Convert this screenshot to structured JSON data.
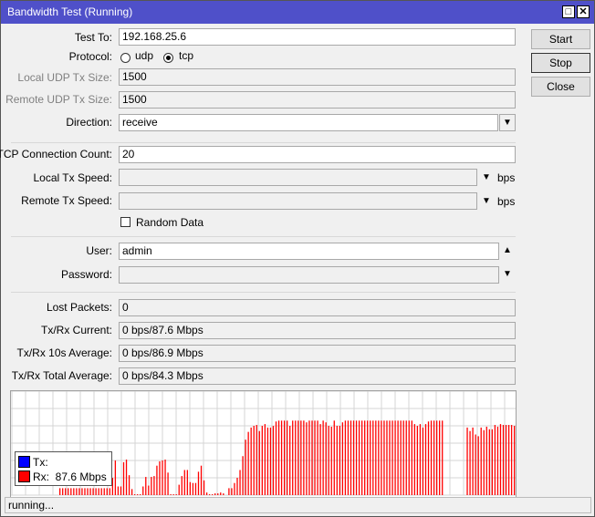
{
  "window": {
    "title": "Bandwidth Test (Running)",
    "maximize_icon": "maximize-icon",
    "close_icon": "close-icon"
  },
  "form": {
    "test_to": {
      "label": "Test To:",
      "value": "192.168.25.6"
    },
    "protocol": {
      "label": "Protocol:",
      "options": [
        "udp",
        "tcp"
      ],
      "selected": "tcp"
    },
    "local_udp_tx_size": {
      "label": "Local UDP Tx Size:",
      "value": "1500"
    },
    "remote_udp_tx_size": {
      "label": "Remote UDP Tx Size:",
      "value": "1500"
    },
    "direction": {
      "label": "Direction:",
      "value": "receive"
    },
    "tcp_connection_count": {
      "label": "TCP Connection Count:",
      "value": "20"
    },
    "local_tx_speed": {
      "label": "Local Tx Speed:",
      "value": "",
      "unit": "bps"
    },
    "remote_tx_speed": {
      "label": "Remote Tx Speed:",
      "value": "",
      "unit": "bps"
    },
    "random_data": {
      "label": "Random Data",
      "checked": false
    },
    "user": {
      "label": "User:",
      "value": "admin"
    },
    "password": {
      "label": "Password:",
      "value": ""
    },
    "lost_packets": {
      "label": "Lost Packets:",
      "value": "0"
    },
    "current": {
      "label": "Tx/Rx Current:",
      "value": "0 bps/87.6 Mbps"
    },
    "avg10": {
      "label": "Tx/Rx 10s Average:",
      "value": "0 bps/86.9 Mbps"
    },
    "total_avg": {
      "label": "Tx/Rx Total Average:",
      "value": "0 bps/84.3 Mbps"
    }
  },
  "buttons": {
    "start": "Start",
    "stop": "Stop",
    "close": "Close"
  },
  "graph": {
    "legend": {
      "tx_label": "Tx:",
      "rx_label": "Rx:  87.6 Mbps",
      "tx_color": "#0000ff",
      "rx_color": "#ff0000"
    },
    "rx_mbps": [
      8,
      8,
      8,
      8,
      8,
      8,
      8,
      8,
      8,
      8,
      8,
      8,
      8,
      8,
      8,
      8,
      8,
      8,
      8,
      20,
      40,
      10,
      10,
      38,
      41,
      23,
      7,
      1,
      1,
      1,
      10,
      21,
      11,
      21,
      22,
      34,
      39,
      40,
      41,
      26,
      1,
      1,
      1,
      12,
      22,
      29,
      29,
      15,
      14,
      14,
      27,
      34,
      17,
      3,
      1,
      1,
      2,
      2,
      3,
      2,
      0,
      8,
      8,
      14,
      20,
      29,
      45,
      64,
      73,
      78,
      80,
      81,
      74,
      80,
      82,
      78,
      78,
      80,
      85,
      86,
      86,
      86,
      86,
      80,
      86,
      86,
      86,
      86,
      86,
      84,
      86,
      86,
      86,
      86,
      82,
      86,
      84,
      80,
      79,
      86,
      80,
      80,
      84,
      86,
      86,
      86,
      86,
      86,
      86,
      86,
      86,
      86,
      86,
      86,
      86,
      86,
      86,
      86,
      86,
      86,
      86,
      86,
      86,
      86,
      86,
      86,
      86,
      86,
      82,
      80,
      82,
      78,
      82,
      85,
      86,
      86,
      86,
      86,
      86,
      0,
      0,
      0,
      0,
      0,
      0,
      0,
      0,
      78,
      74,
      78,
      70,
      68,
      78,
      75,
      79,
      76,
      76,
      81,
      79,
      82,
      81,
      81,
      81,
      81,
      80
    ]
  },
  "status": {
    "text": "running..."
  }
}
